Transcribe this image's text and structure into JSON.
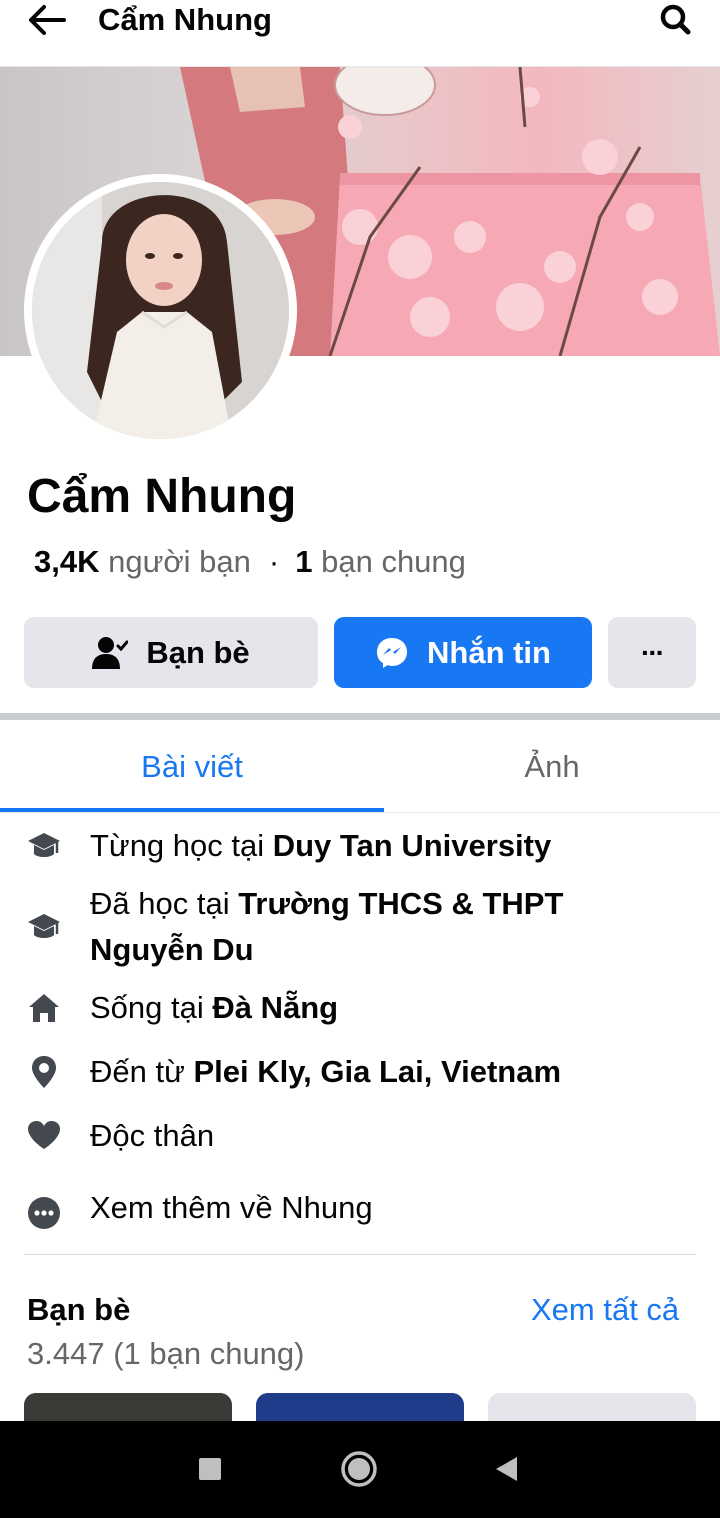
{
  "topbar": {
    "title": "Cẩm Nhung"
  },
  "profile": {
    "name": "Cẩm Nhung",
    "friend_count": "3,4K",
    "friend_count_label": "người bạn",
    "mutual_count": "1",
    "mutual_label": "bạn chung"
  },
  "actions": {
    "friends_label": "Bạn bè",
    "message_label": "Nhắn tin",
    "more_label": "···"
  },
  "tabs": [
    {
      "label": "Bài viết",
      "active": true
    },
    {
      "label": "Ảnh",
      "active": false
    }
  ],
  "intro": [
    {
      "icon": "graduation-cap-icon",
      "prefix": "Từng học tại ",
      "bold": "Duy Tan University"
    },
    {
      "icon": "graduation-cap-icon",
      "prefix": "Đã học tại ",
      "bold": "Trường THCS & THPT Nguyễn Du"
    },
    {
      "icon": "home-icon",
      "prefix": "Sống tại ",
      "bold": "Đà Nẵng"
    },
    {
      "icon": "location-pin-icon",
      "prefix": "Đến từ ",
      "bold": "Plei Kly, Gia Lai, Vietnam"
    },
    {
      "icon": "heart-icon",
      "prefix": "Độc thân",
      "bold": ""
    },
    {
      "icon": "more-circle-icon",
      "prefix": "Xem thêm về Nhung",
      "bold": ""
    }
  ],
  "friends": {
    "title": "Bạn bè",
    "see_all": "Xem tất cả",
    "count": "3.447 (1 bạn chung)"
  },
  "colors": {
    "accent": "#1877f2",
    "button_gray": "#e4e6eb",
    "secondary_text": "#65676b"
  }
}
